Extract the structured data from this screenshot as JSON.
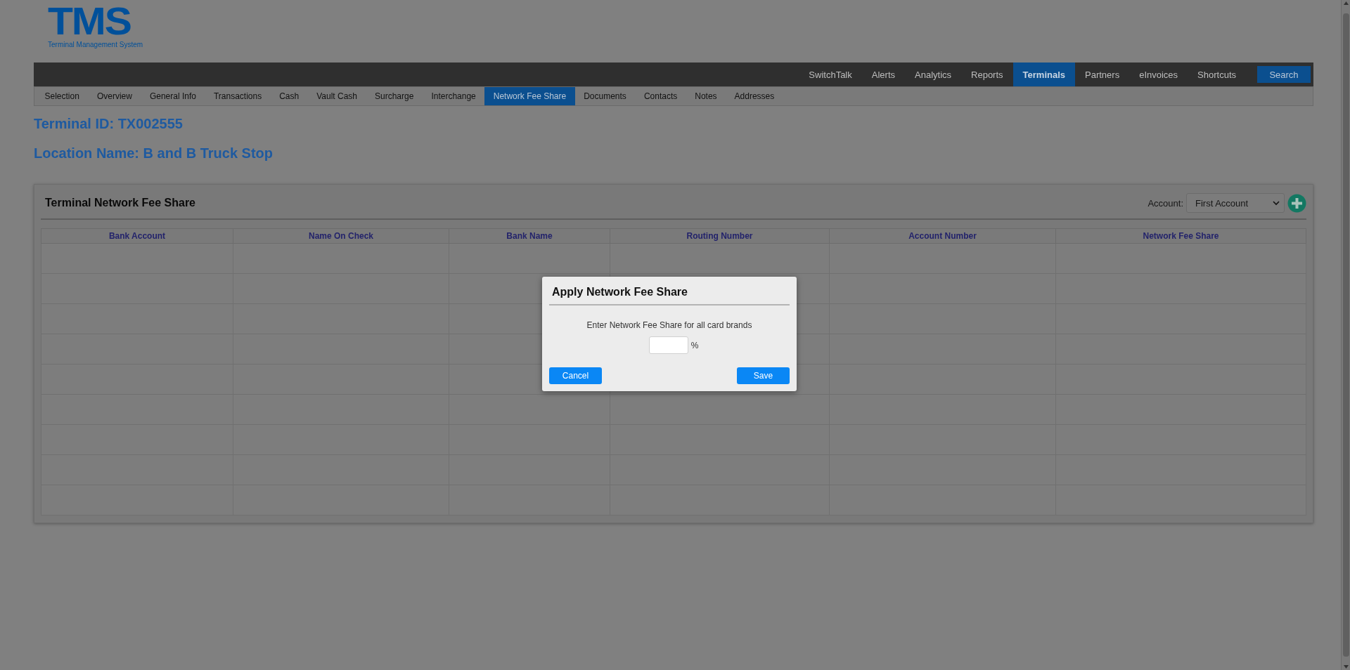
{
  "logo": {
    "mark": "TMS",
    "tagline": "Terminal Management System"
  },
  "main_nav": [
    {
      "label": "SwitchTalk",
      "selected": false
    },
    {
      "label": "Alerts",
      "selected": false
    },
    {
      "label": "Analytics",
      "selected": false
    },
    {
      "label": "Reports",
      "selected": false
    },
    {
      "label": "Terminals",
      "selected": true
    },
    {
      "label": "Partners",
      "selected": false
    },
    {
      "label": "eInvoices",
      "selected": false
    },
    {
      "label": "Shortcuts",
      "selected": false
    }
  ],
  "search_button": "Search",
  "sub_nav": [
    {
      "label": "Selection",
      "selected": false
    },
    {
      "label": "Overview",
      "selected": false
    },
    {
      "label": "General Info",
      "selected": false
    },
    {
      "label": "Transactions",
      "selected": false
    },
    {
      "label": "Cash",
      "selected": false
    },
    {
      "label": "Vault Cash",
      "selected": false
    },
    {
      "label": "Surcharge",
      "selected": false
    },
    {
      "label": "Interchange",
      "selected": false
    },
    {
      "label": "Network Fee Share",
      "selected": true
    },
    {
      "label": "Documents",
      "selected": false
    },
    {
      "label": "Contacts",
      "selected": false
    },
    {
      "label": "Notes",
      "selected": false
    },
    {
      "label": "Addresses",
      "selected": false
    }
  ],
  "terminal_id": "Terminal ID: TX002555",
  "location_name": "Location Name: B and B Truck Stop",
  "panel": {
    "title": "Terminal Network Fee Share",
    "account_label": "Account:",
    "account_value": "First Account",
    "table": {
      "columns": [
        "Bank Account",
        "Name On Check",
        "Bank Name",
        "Routing Number",
        "Account Number",
        "Network Fee Share"
      ]
    }
  },
  "dialog": {
    "title": "Apply Network Fee Share",
    "prompt": "Enter Network Fee Share for all card brands",
    "unit": "%",
    "buttons": [
      "Cancel",
      "Save"
    ]
  }
}
